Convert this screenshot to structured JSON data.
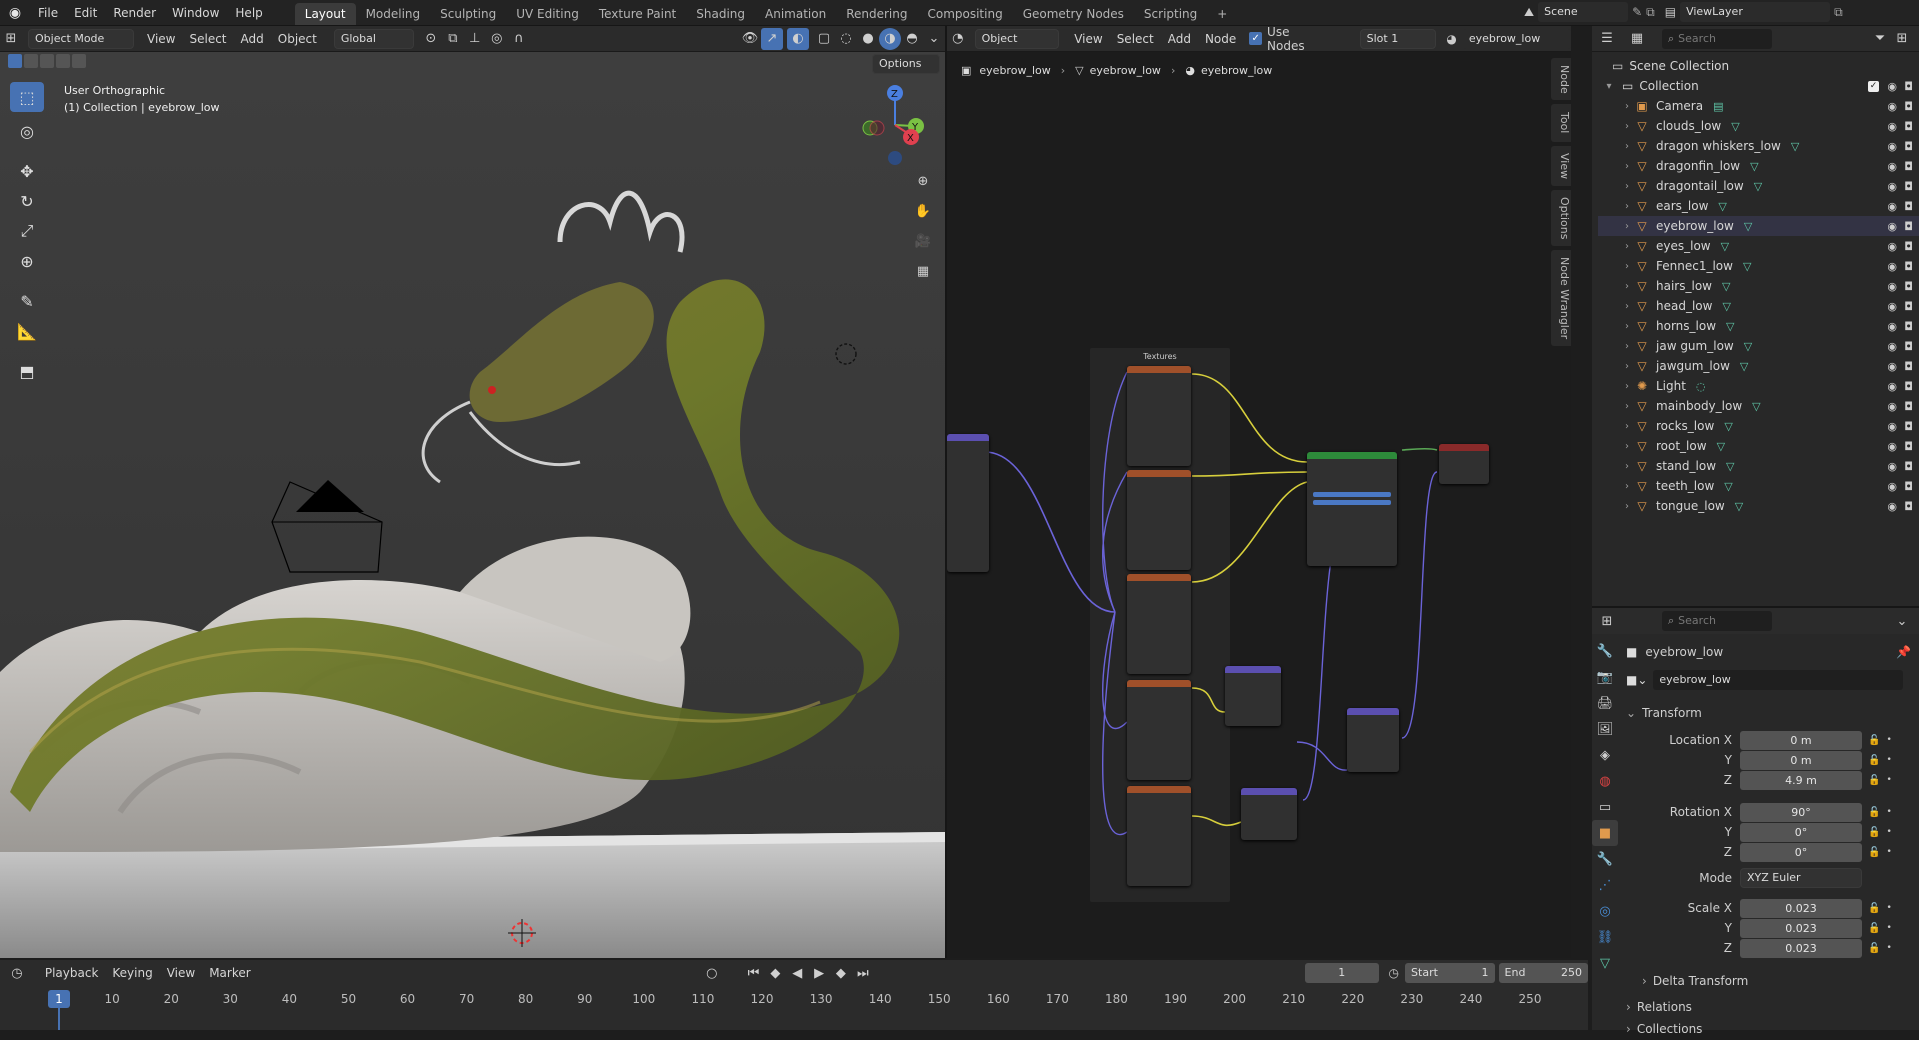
{
  "menu": [
    "File",
    "Edit",
    "Render",
    "Window",
    "Help"
  ],
  "workspaces": [
    "Layout",
    "Modeling",
    "Sculpting",
    "UV Editing",
    "Texture Paint",
    "Shading",
    "Animation",
    "Rendering",
    "Compositing",
    "Geometry Nodes",
    "Scripting",
    "+"
  ],
  "active_workspace": "Layout",
  "scene": {
    "label": "Scene",
    "view_layer": "ViewLayer"
  },
  "viewport": {
    "mode": "Object Mode",
    "menus": [
      "View",
      "Select",
      "Add",
      "Object"
    ],
    "transform_orientation": "Global",
    "options": "Options",
    "overlay_title": "User Orthographic",
    "overlay_sub": "(1) Collection | eyebrow_low",
    "gizmo": {
      "z": "Z",
      "y": "Y",
      "x": "X"
    }
  },
  "node_editor": {
    "type": "Object",
    "menus": [
      "View",
      "Select",
      "Add",
      "Node"
    ],
    "use_nodes_label": "Use Nodes",
    "slot": "Slot 1",
    "material": "eyebrow_low",
    "breadcrumb": [
      "eyebrow_low",
      "eyebrow_low",
      "eyebrow_low"
    ],
    "frame_label": "Textures",
    "side_tabs": [
      "Node",
      "Tool",
      "View",
      "Options",
      "Node Wrangler"
    ]
  },
  "outliner": {
    "search_placeholder": "Search",
    "scene_collection": "Scene Collection",
    "collection": "Collection",
    "items": [
      {
        "name": "Camera",
        "kind": "camera"
      },
      {
        "name": "clouds_low",
        "kind": "mesh"
      },
      {
        "name": "dragon whiskers_low",
        "kind": "mesh"
      },
      {
        "name": "dragonfin_low",
        "kind": "mesh"
      },
      {
        "name": "dragontail_low",
        "kind": "mesh"
      },
      {
        "name": "ears_low",
        "kind": "mesh"
      },
      {
        "name": "eyebrow_low",
        "kind": "mesh"
      },
      {
        "name": "eyes_low",
        "kind": "mesh"
      },
      {
        "name": "Fennec1_low",
        "kind": "mesh"
      },
      {
        "name": "hairs_low",
        "kind": "mesh"
      },
      {
        "name": "head_low",
        "kind": "mesh"
      },
      {
        "name": "horns_low",
        "kind": "mesh"
      },
      {
        "name": "jaw gum_low",
        "kind": "mesh"
      },
      {
        "name": "jawgum_low",
        "kind": "mesh"
      },
      {
        "name": "Light",
        "kind": "light"
      },
      {
        "name": "mainbody_low",
        "kind": "mesh"
      },
      {
        "name": "rocks_low",
        "kind": "mesh"
      },
      {
        "name": "root_low",
        "kind": "mesh"
      },
      {
        "name": "stand_low",
        "kind": "mesh"
      },
      {
        "name": "teeth_low",
        "kind": "mesh"
      },
      {
        "name": "tongue_low",
        "kind": "mesh"
      }
    ]
  },
  "properties": {
    "search_placeholder": "Search",
    "object_name": "eyebrow_low",
    "object_field": "eyebrow_low",
    "transform_label": "Transform",
    "location": {
      "label": "Location X",
      "x": "0 m",
      "y": "0 m",
      "z": "4.9 m"
    },
    "rotation": {
      "label": "Rotation X",
      "x": "90°",
      "y": "0°",
      "z": "0°"
    },
    "mode_label": "Mode",
    "mode_value": "XYZ Euler",
    "scale": {
      "label": "Scale X",
      "x": "0.023",
      "y": "0.023",
      "z": "0.023"
    },
    "axis_y": "Y",
    "axis_z": "Z",
    "sections": [
      "Delta Transform",
      "Relations",
      "Collections"
    ]
  },
  "timeline": {
    "menus": [
      "Playback",
      "Keying",
      "View",
      "Marker"
    ],
    "current_frame": "1",
    "start_label": "Start",
    "start": "1",
    "end_label": "End",
    "end": "250",
    "ticks": [
      "1",
      "10",
      "20",
      "30",
      "40",
      "50",
      "60",
      "70",
      "80",
      "90",
      "100",
      "110",
      "120",
      "130",
      "140",
      "150",
      "160",
      "170",
      "180",
      "190",
      "200",
      "210",
      "220",
      "230",
      "240",
      "250"
    ]
  },
  "colors": {
    "accent": "#4772b3",
    "mesh_icon": "#e09a4d",
    "modifier_icon": "#5fc7a8",
    "node_texture": "#a0502a",
    "node_shader": "#2d8a3a",
    "node_vector": "#5b4fb0"
  }
}
